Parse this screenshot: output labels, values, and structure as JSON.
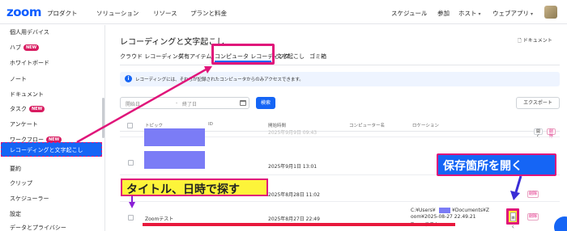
{
  "nav": {
    "logo": "zoom",
    "items": [
      "プロダクト",
      "ソリューション",
      "リソース",
      "プランと料金"
    ],
    "right_items": [
      "スケジュール",
      "参加",
      "ホスト",
      "ウェブアプリ"
    ]
  },
  "sidebar": {
    "items": [
      {
        "label": "個人用デバイス",
        "new": false
      },
      {
        "label": "ハブ",
        "new": true
      },
      {
        "label": "ホワイトボード",
        "new": false
      },
      {
        "label": "ノート",
        "new": false
      },
      {
        "label": "ドキュメント",
        "new": false
      },
      {
        "label": "タスク",
        "new": true
      },
      {
        "label": "アンケート",
        "new": false
      },
      {
        "label": "ワークフロー",
        "new": true
      }
    ],
    "active": "レコーディングと文字起こし",
    "items_after": [
      "要約",
      "クリップ",
      "スケジューラー",
      "設定",
      "データとプライバシー"
    ],
    "new_label": "NEW"
  },
  "main": {
    "title": "レコーディングと文字起こし",
    "doc_link": "ドキュメント",
    "tabs": [
      "クラウド レコーディング",
      "共有アイテム",
      "コンピュータ レコーディング",
      "文字起こし",
      "ゴミ箱"
    ],
    "active_tab": "コンピュータ レコーディング",
    "info": "レコーディングには、それらが記録されたコンピュータからのみアクセスできます。",
    "date_start": "開始日",
    "date_sep": "-",
    "date_end": "終了日",
    "search": "検索",
    "export": "エクスポート",
    "columns": [
      "トピック",
      "ID",
      "開始時間",
      "コンピューター名",
      "ロケーション"
    ],
    "rows": [
      {
        "topic": "",
        "time": "2025年9月9日 09:43",
        "open": "開く",
        "delete": "削除"
      },
      {
        "topic": "",
        "time": "2025年9月1日 13:01",
        "open": "",
        "delete": ""
      },
      {
        "topic": "",
        "time": "2025年8月28日 11:02",
        "open": "開く",
        "delete": "削除"
      },
      {
        "topic": "Zoomテスト",
        "time": "2025年8月27日 22:49",
        "location": [
          "C:¥Users¥",
          "¥Documents¥Z",
          "oom¥2025-08-27 22.49.21",
          "Zoomテスト"
        ],
        "open": "開く",
        "delete": "削除"
      }
    ]
  },
  "annotations": {
    "search_hint": "タイトル、日時で探す",
    "open_hint": "保存箇所を開く"
  },
  "colors": {
    "accent": "#1565f5",
    "highlight": "#e0157a",
    "yellow": "#fdf43a",
    "redact": "#7b7cf6"
  }
}
